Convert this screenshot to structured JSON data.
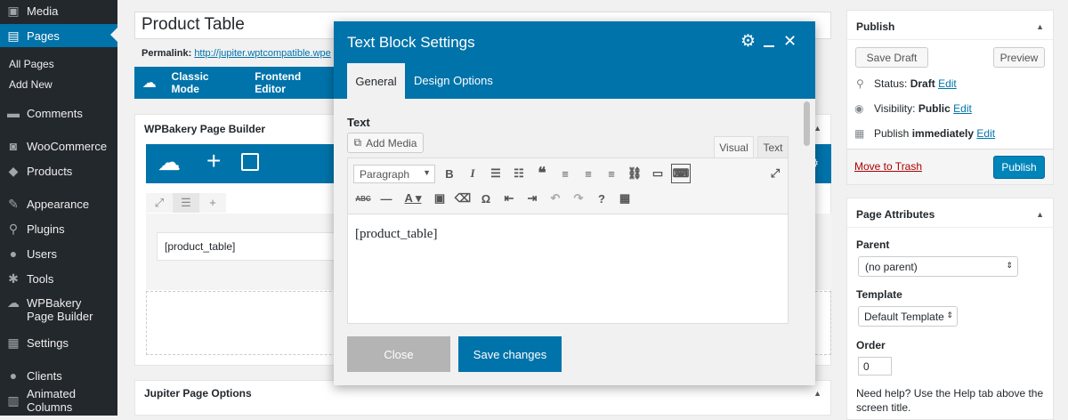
{
  "sidebar": {
    "items": [
      {
        "label": "Media",
        "icon": "media-icon"
      },
      {
        "label": "Pages",
        "icon": "pages-icon"
      },
      {
        "label": "Comments",
        "icon": "comments-icon"
      },
      {
        "label": "WooCommerce",
        "icon": "woocommerce-icon"
      },
      {
        "label": "Products",
        "icon": "products-icon"
      },
      {
        "label": "Appearance",
        "icon": "appearance-icon"
      },
      {
        "label": "Plugins",
        "icon": "plugins-icon"
      },
      {
        "label": "Users",
        "icon": "users-icon"
      },
      {
        "label": "Tools",
        "icon": "tools-icon"
      },
      {
        "label": "WPBakery Page Builder",
        "icon": "wpbakery-icon"
      },
      {
        "label": "Settings",
        "icon": "settings-icon"
      },
      {
        "label": "Clients",
        "icon": "clients-icon"
      },
      {
        "label": "Animated Columns",
        "icon": "animated-columns-icon"
      }
    ],
    "submenu": [
      "All Pages",
      "Add New"
    ]
  },
  "editor": {
    "title": "Product Table",
    "permalink_label": "Permalink:",
    "permalink_url": "http://jupiter.wptcompatible.wpe",
    "mode_buttons": [
      "Classic Mode",
      "Frontend Editor"
    ],
    "builder_title": "WPBakery Page Builder",
    "element_text": "[product_table]",
    "jupiter_title": "Jupiter Page Options"
  },
  "modal": {
    "title": "Text Block Settings",
    "tabs": [
      "General",
      "Design Options"
    ],
    "field_label": "Text",
    "add_media": "Add Media",
    "editor_tabs": [
      "Visual",
      "Text"
    ],
    "format_select": "Paragraph",
    "content": "[product_table]",
    "close_label": "Close",
    "save_label": "Save changes"
  },
  "publish": {
    "title": "Publish",
    "save_draft": "Save Draft",
    "preview": "Preview",
    "status_label": "Status:",
    "status_value": "Draft",
    "visibility_label": "Visibility:",
    "visibility_value": "Public",
    "publish_label": "Publish",
    "publish_value": "immediately",
    "edit": "Edit",
    "trash": "Move to Trash",
    "publish_button": "Publish"
  },
  "attributes": {
    "title": "Page Attributes",
    "parent_label": "Parent",
    "parent_value": "(no parent)",
    "template_label": "Template",
    "template_value": "Default Template",
    "order_label": "Order",
    "order_value": "0",
    "help": "Need help? Use the Help tab above the screen title."
  },
  "colors": {
    "primary": "#0073aa",
    "sidebar": "#23282d",
    "trash": "#a00"
  }
}
